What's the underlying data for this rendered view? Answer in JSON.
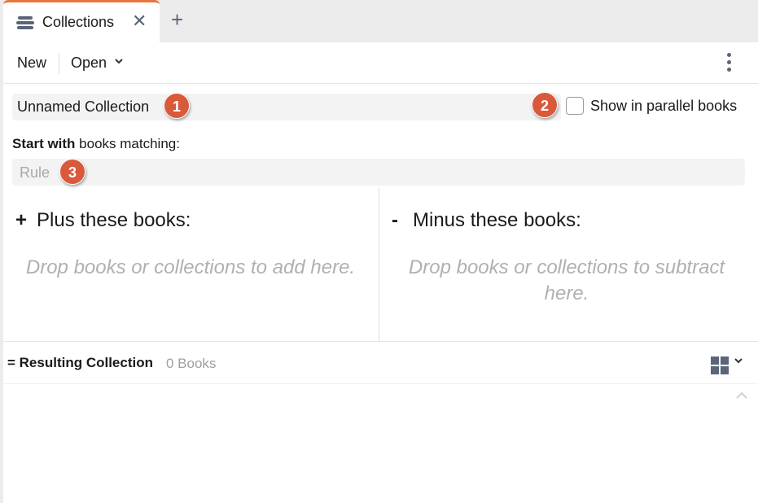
{
  "tabs": [
    {
      "label": "Collections",
      "icon": "collections-icon",
      "close": "✕"
    }
  ],
  "add_tab": "+",
  "toolbar": {
    "new_label": "New",
    "open_label": "Open",
    "open_chevron": "⌄",
    "more_icon": "vertical-ellipsis-icon"
  },
  "collection": {
    "name": "Unnamed Collection",
    "badge_1": "1",
    "badge_2": "2",
    "parallel_label": "Show in parallel books",
    "start_bold": "Start with",
    "start_rest": " books matching:",
    "rule_placeholder": "Rule",
    "badge_3": "3"
  },
  "plus": {
    "symbol": "+",
    "title": "Plus these books:",
    "hint": "Drop books or collections to add here."
  },
  "minus": {
    "symbol": "-",
    "title": "Minus these books:",
    "hint": "Drop books or collections to subtract here."
  },
  "result": {
    "title": "= Resulting Collection",
    "count": "0 Books",
    "view_icon": "grid-view-icon",
    "view_chevron": "⌄"
  },
  "colors": {
    "accent": "#e8743b",
    "badge": "#d9593b",
    "icon": "#5b6577"
  }
}
